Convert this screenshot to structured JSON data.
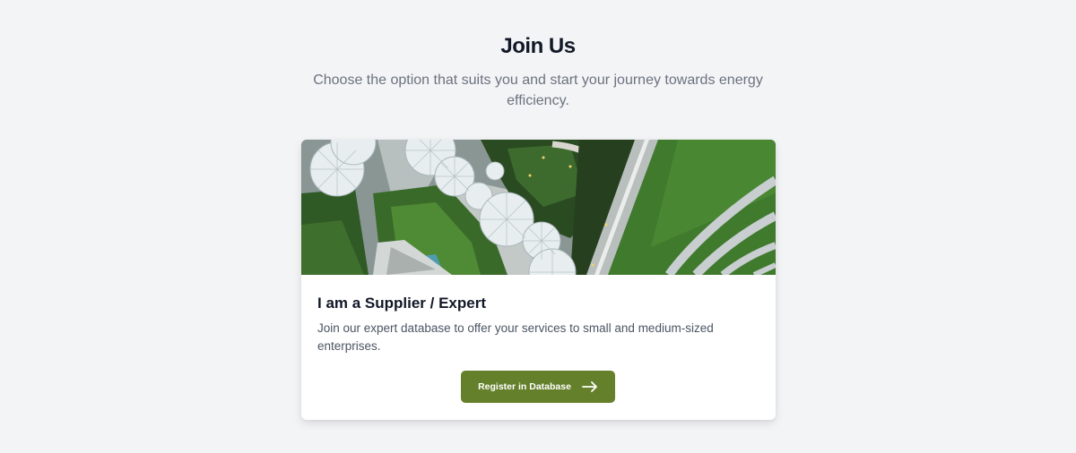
{
  "page": {
    "title": "Join Us",
    "subtitle": "Choose the option that suits you and start your journey towards energy efficiency."
  },
  "card": {
    "image_icon": "aerial-park-photo",
    "title": "I am a Supplier / Expert",
    "description": "Join our expert database to offer your services to small and medium-sized enterprises.",
    "button_label": "Register in Database",
    "button_icon": "arrow-right-icon",
    "accent_color": "#65802b"
  }
}
